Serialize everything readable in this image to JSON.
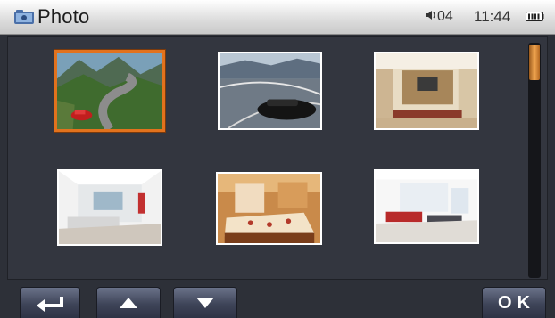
{
  "header": {
    "app_icon": "photo-folder-icon",
    "title": "Photo",
    "volume_icon": "speaker-icon",
    "volume": "04",
    "time": "11:44",
    "battery_icon": "battery-icon"
  },
  "gallery": {
    "selected_index": 0,
    "items": [
      {
        "name": "mountain-road-red-car",
        "icon": "photo-thumbnail"
      },
      {
        "name": "highway-black-car",
        "icon": "photo-thumbnail"
      },
      {
        "name": "living-room-tv",
        "icon": "photo-thumbnail"
      },
      {
        "name": "white-living-room",
        "icon": "photo-thumbnail"
      },
      {
        "name": "warm-bedroom",
        "icon": "photo-thumbnail"
      },
      {
        "name": "bright-living-room",
        "icon": "photo-thumbnail"
      }
    ]
  },
  "scrollbar": {
    "position": 0.0,
    "visible_fraction": 0.15
  },
  "buttons": {
    "back_icon": "return-arrow-icon",
    "up_icon": "up-triangle-icon",
    "down_icon": "down-triangle-icon",
    "ok_label": "OK"
  },
  "colors": {
    "selection": "#e2721d",
    "panel": "#33363f",
    "background": "#2d3038",
    "button": "#3e4458"
  }
}
